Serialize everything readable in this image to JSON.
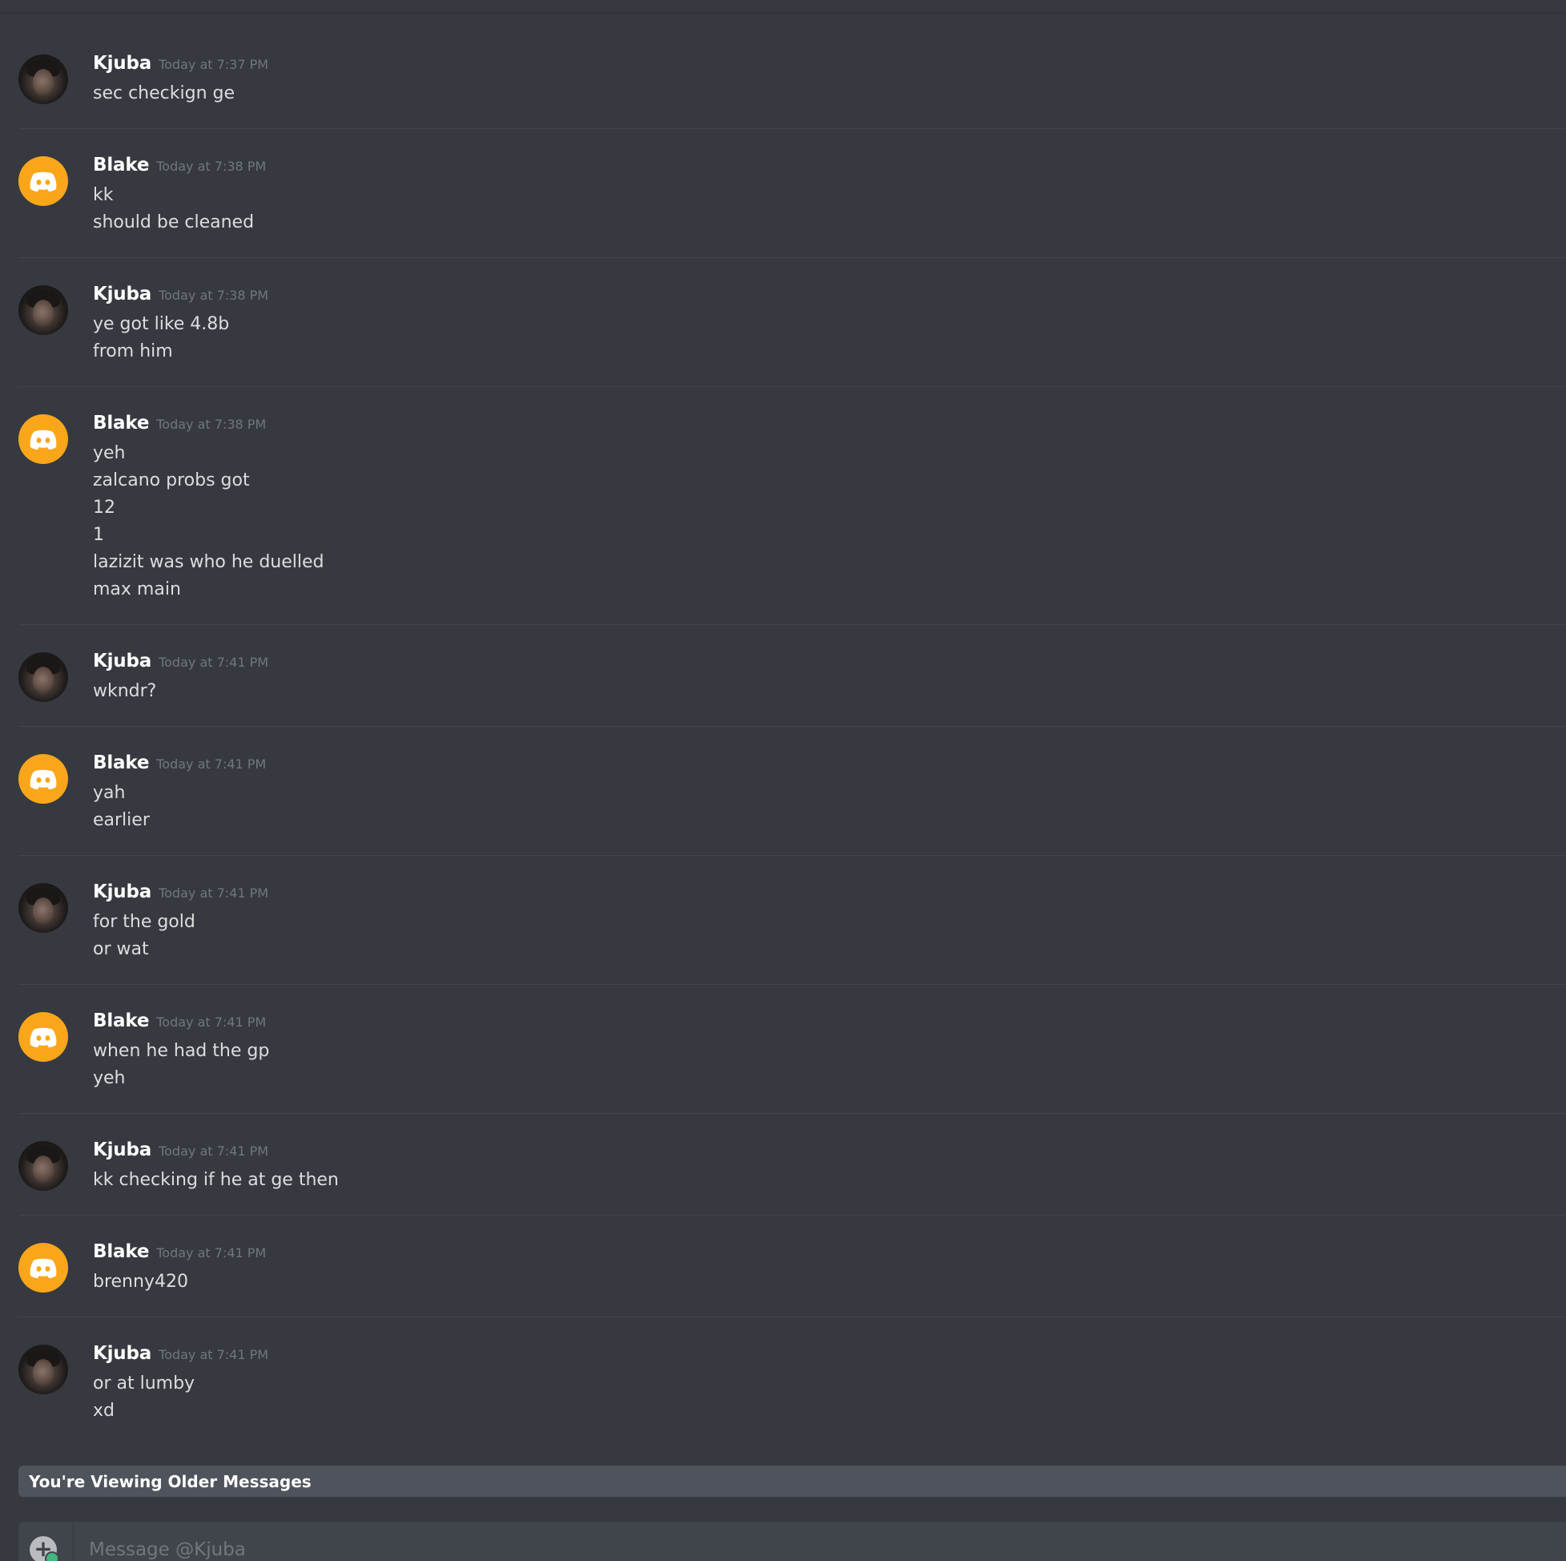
{
  "conversation": {
    "messages": [
      {
        "author": "Kjuba",
        "avatar": "photo",
        "time": "Today at 7:37 PM",
        "lines": [
          "sec checkign ge"
        ]
      },
      {
        "author": "Blake",
        "avatar": "bot",
        "time": "Today at 7:38 PM",
        "lines": [
          "kk",
          "should be cleaned"
        ]
      },
      {
        "author": "Kjuba",
        "avatar": "photo",
        "time": "Today at 7:38 PM",
        "lines": [
          "ye got like 4.8b",
          "from him"
        ]
      },
      {
        "author": "Blake",
        "avatar": "bot",
        "time": "Today at 7:38 PM",
        "lines": [
          "yeh",
          "zalcano probs got",
          "12",
          "1",
          "lazizit was who he duelled",
          "max main"
        ]
      },
      {
        "author": "Kjuba",
        "avatar": "photo",
        "time": "Today at 7:41 PM",
        "lines": [
          "wkndr?"
        ]
      },
      {
        "author": "Blake",
        "avatar": "bot",
        "time": "Today at 7:41 PM",
        "lines": [
          "yah",
          "earlier"
        ]
      },
      {
        "author": "Kjuba",
        "avatar": "photo",
        "time": "Today at 7:41 PM",
        "lines": [
          "for the gold",
          "or wat"
        ]
      },
      {
        "author": "Blake",
        "avatar": "bot",
        "time": "Today at 7:41 PM",
        "lines": [
          "when he had the gp",
          "yeh"
        ]
      },
      {
        "author": "Kjuba",
        "avatar": "photo",
        "time": "Today at 7:41 PM",
        "lines": [
          "kk checking if he at ge then"
        ]
      },
      {
        "author": "Blake",
        "avatar": "bot",
        "time": "Today at 7:41 PM",
        "lines": [
          "brenny420"
        ]
      },
      {
        "author": "Kjuba",
        "avatar": "photo",
        "time": "Today at 7:41 PM",
        "lines": [
          "or at lumby",
          "xd"
        ]
      }
    ]
  },
  "older_banner": {
    "text": "You're Viewing Older Messages"
  },
  "composer": {
    "placeholder": "Message @Kjuba",
    "attach_icon": "plus-circle-icon"
  },
  "colors": {
    "background": "#36393f",
    "bot_avatar": "#faa61a",
    "banner": "#4f545c",
    "composer": "#40444b"
  }
}
